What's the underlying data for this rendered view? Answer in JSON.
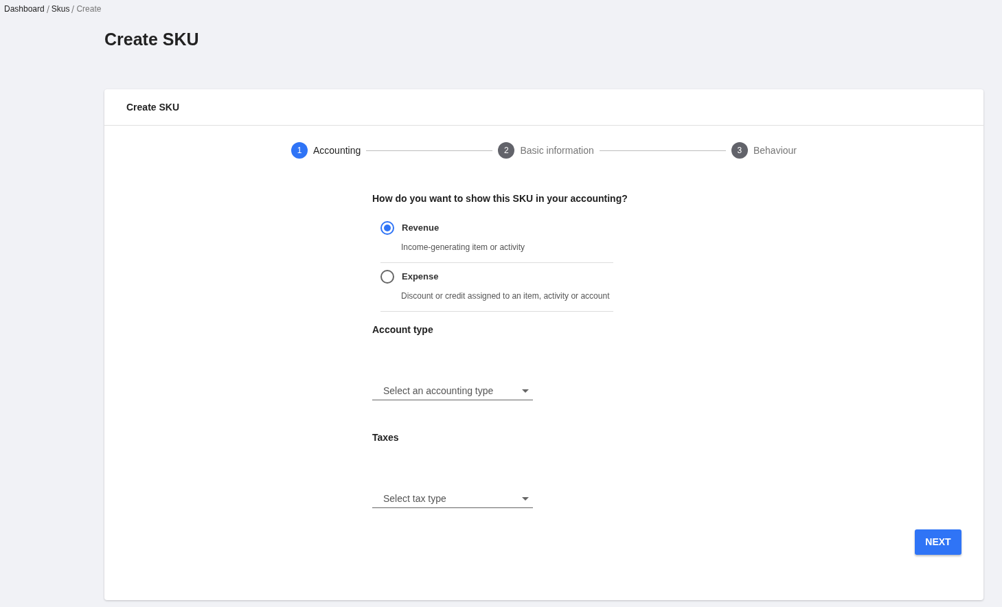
{
  "breadcrumbs": [
    {
      "label": "Dashboard",
      "current": false
    },
    {
      "label": "Skus",
      "current": false
    },
    {
      "label": "Create",
      "current": true
    }
  ],
  "page_title": "Create SKU",
  "card": {
    "title": "Create SKU",
    "steps": [
      {
        "number": "1",
        "label": "Accounting",
        "selected": true
      },
      {
        "number": "2",
        "label": "Basic information",
        "selected": false
      },
      {
        "number": "3",
        "label": "Behaviour",
        "selected": false
      }
    ],
    "question": "How do you want to show this SKU in your accounting?",
    "options": [
      {
        "label": "Revenue",
        "description": "Income-generating item or activity",
        "selected": true
      },
      {
        "label": "Expense",
        "description": "Discount or credit assigned to an item, activity or account",
        "selected": false
      }
    ],
    "fields": [
      {
        "label": "Account type",
        "placeholder": "Select an accounting type"
      },
      {
        "label": "Taxes",
        "placeholder": "Select tax type"
      }
    ],
    "next_button": "NEXT"
  }
}
